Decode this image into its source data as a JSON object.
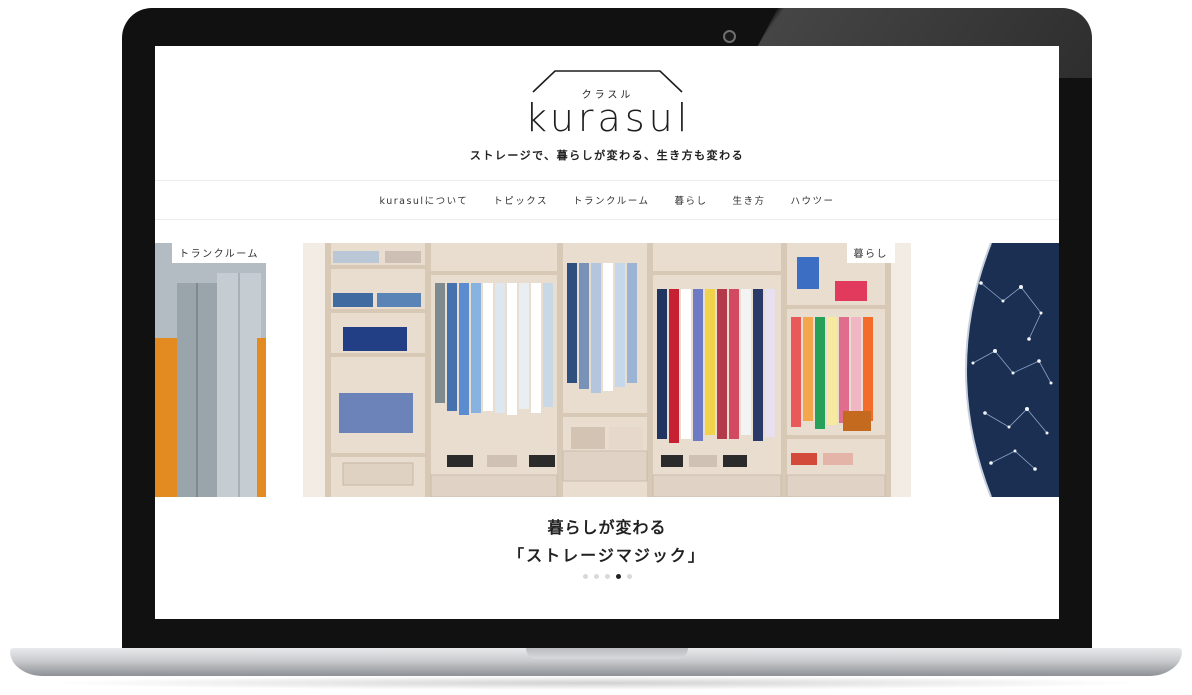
{
  "site": {
    "logo_kana": "クラスル",
    "logo_word": "kurasul",
    "tagline": "ストレージで、暮らしが変わる、生き方も変わる"
  },
  "nav": {
    "items": [
      {
        "label": "kurasulについて"
      },
      {
        "label": "トピックス"
      },
      {
        "label": "トランクルーム"
      },
      {
        "label": "暮らし"
      },
      {
        "label": "生き方"
      },
      {
        "label": "ハウツー"
      }
    ]
  },
  "slider": {
    "left_tag": "トランクルーム",
    "main_tag": "暮らし",
    "caption_line1": "暮らしが変わる",
    "caption_line2": "「ストレージマジック」",
    "dots_total": 5,
    "active_dot_index": 3
  },
  "colors": {
    "bezel": "#111111",
    "accent_text": "#222222",
    "night_sky": "#182b4c",
    "wardrobe_wood": "#ede5dc"
  },
  "icons": [
    "camera-icon",
    "roof-logo-icon"
  ]
}
